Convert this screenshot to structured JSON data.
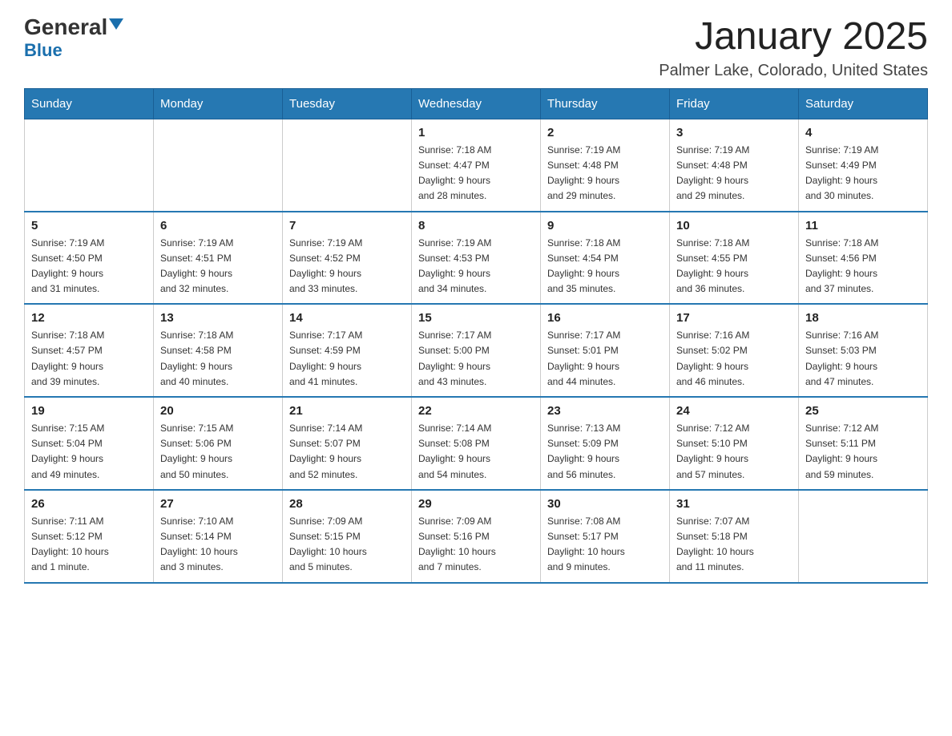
{
  "logo": {
    "text_general": "General",
    "text_blue": "Blue",
    "subtitle": "Blue"
  },
  "header": {
    "title": "January 2025",
    "location": "Palmer Lake, Colorado, United States"
  },
  "days_of_week": [
    "Sunday",
    "Monday",
    "Tuesday",
    "Wednesday",
    "Thursday",
    "Friday",
    "Saturday"
  ],
  "weeks": [
    [
      {
        "day": "",
        "info": ""
      },
      {
        "day": "",
        "info": ""
      },
      {
        "day": "",
        "info": ""
      },
      {
        "day": "1",
        "info": "Sunrise: 7:18 AM\nSunset: 4:47 PM\nDaylight: 9 hours\nand 28 minutes."
      },
      {
        "day": "2",
        "info": "Sunrise: 7:19 AM\nSunset: 4:48 PM\nDaylight: 9 hours\nand 29 minutes."
      },
      {
        "day": "3",
        "info": "Sunrise: 7:19 AM\nSunset: 4:48 PM\nDaylight: 9 hours\nand 29 minutes."
      },
      {
        "day": "4",
        "info": "Sunrise: 7:19 AM\nSunset: 4:49 PM\nDaylight: 9 hours\nand 30 minutes."
      }
    ],
    [
      {
        "day": "5",
        "info": "Sunrise: 7:19 AM\nSunset: 4:50 PM\nDaylight: 9 hours\nand 31 minutes."
      },
      {
        "day": "6",
        "info": "Sunrise: 7:19 AM\nSunset: 4:51 PM\nDaylight: 9 hours\nand 32 minutes."
      },
      {
        "day": "7",
        "info": "Sunrise: 7:19 AM\nSunset: 4:52 PM\nDaylight: 9 hours\nand 33 minutes."
      },
      {
        "day": "8",
        "info": "Sunrise: 7:19 AM\nSunset: 4:53 PM\nDaylight: 9 hours\nand 34 minutes."
      },
      {
        "day": "9",
        "info": "Sunrise: 7:18 AM\nSunset: 4:54 PM\nDaylight: 9 hours\nand 35 minutes."
      },
      {
        "day": "10",
        "info": "Sunrise: 7:18 AM\nSunset: 4:55 PM\nDaylight: 9 hours\nand 36 minutes."
      },
      {
        "day": "11",
        "info": "Sunrise: 7:18 AM\nSunset: 4:56 PM\nDaylight: 9 hours\nand 37 minutes."
      }
    ],
    [
      {
        "day": "12",
        "info": "Sunrise: 7:18 AM\nSunset: 4:57 PM\nDaylight: 9 hours\nand 39 minutes."
      },
      {
        "day": "13",
        "info": "Sunrise: 7:18 AM\nSunset: 4:58 PM\nDaylight: 9 hours\nand 40 minutes."
      },
      {
        "day": "14",
        "info": "Sunrise: 7:17 AM\nSunset: 4:59 PM\nDaylight: 9 hours\nand 41 minutes."
      },
      {
        "day": "15",
        "info": "Sunrise: 7:17 AM\nSunset: 5:00 PM\nDaylight: 9 hours\nand 43 minutes."
      },
      {
        "day": "16",
        "info": "Sunrise: 7:17 AM\nSunset: 5:01 PM\nDaylight: 9 hours\nand 44 minutes."
      },
      {
        "day": "17",
        "info": "Sunrise: 7:16 AM\nSunset: 5:02 PM\nDaylight: 9 hours\nand 46 minutes."
      },
      {
        "day": "18",
        "info": "Sunrise: 7:16 AM\nSunset: 5:03 PM\nDaylight: 9 hours\nand 47 minutes."
      }
    ],
    [
      {
        "day": "19",
        "info": "Sunrise: 7:15 AM\nSunset: 5:04 PM\nDaylight: 9 hours\nand 49 minutes."
      },
      {
        "day": "20",
        "info": "Sunrise: 7:15 AM\nSunset: 5:06 PM\nDaylight: 9 hours\nand 50 minutes."
      },
      {
        "day": "21",
        "info": "Sunrise: 7:14 AM\nSunset: 5:07 PM\nDaylight: 9 hours\nand 52 minutes."
      },
      {
        "day": "22",
        "info": "Sunrise: 7:14 AM\nSunset: 5:08 PM\nDaylight: 9 hours\nand 54 minutes."
      },
      {
        "day": "23",
        "info": "Sunrise: 7:13 AM\nSunset: 5:09 PM\nDaylight: 9 hours\nand 56 minutes."
      },
      {
        "day": "24",
        "info": "Sunrise: 7:12 AM\nSunset: 5:10 PM\nDaylight: 9 hours\nand 57 minutes."
      },
      {
        "day": "25",
        "info": "Sunrise: 7:12 AM\nSunset: 5:11 PM\nDaylight: 9 hours\nand 59 minutes."
      }
    ],
    [
      {
        "day": "26",
        "info": "Sunrise: 7:11 AM\nSunset: 5:12 PM\nDaylight: 10 hours\nand 1 minute."
      },
      {
        "day": "27",
        "info": "Sunrise: 7:10 AM\nSunset: 5:14 PM\nDaylight: 10 hours\nand 3 minutes."
      },
      {
        "day": "28",
        "info": "Sunrise: 7:09 AM\nSunset: 5:15 PM\nDaylight: 10 hours\nand 5 minutes."
      },
      {
        "day": "29",
        "info": "Sunrise: 7:09 AM\nSunset: 5:16 PM\nDaylight: 10 hours\nand 7 minutes."
      },
      {
        "day": "30",
        "info": "Sunrise: 7:08 AM\nSunset: 5:17 PM\nDaylight: 10 hours\nand 9 minutes."
      },
      {
        "day": "31",
        "info": "Sunrise: 7:07 AM\nSunset: 5:18 PM\nDaylight: 10 hours\nand 11 minutes."
      },
      {
        "day": "",
        "info": ""
      }
    ]
  ]
}
